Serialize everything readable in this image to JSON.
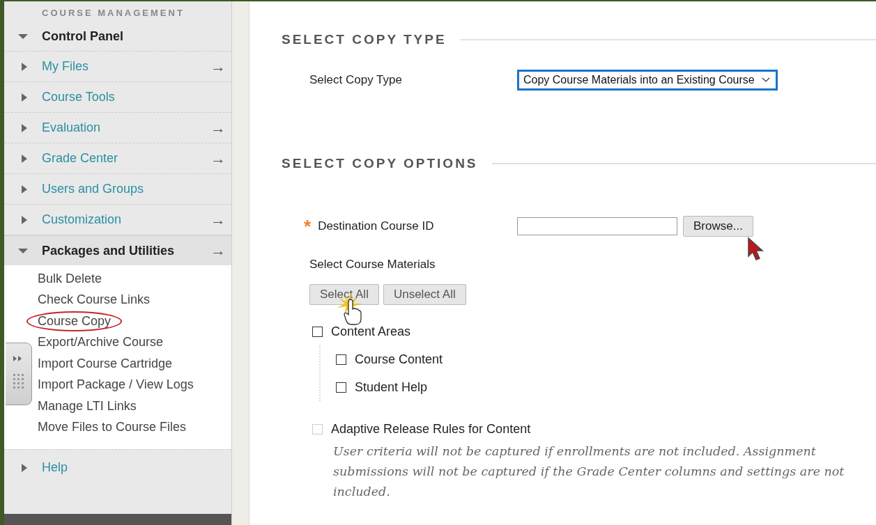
{
  "sidebar": {
    "heading": "COURSE MANAGEMENT",
    "control_panel": {
      "label": "Control Panel",
      "expanded": true
    },
    "items": [
      {
        "label": "My Files",
        "expanded": false,
        "arrow": "→"
      },
      {
        "label": "Course Tools",
        "expanded": false
      },
      {
        "label": "Evaluation",
        "expanded": false,
        "arrow": "→"
      },
      {
        "label": "Grade Center",
        "expanded": false,
        "arrow": "→"
      },
      {
        "label": "Users and Groups",
        "expanded": false
      },
      {
        "label": "Customization",
        "expanded": false,
        "arrow": "→"
      },
      {
        "label": "Packages and Utilities",
        "expanded": true,
        "arrow": "→",
        "children": [
          {
            "label": "Bulk Delete",
            "circled": false
          },
          {
            "label": "Check Course Links",
            "circled": false
          },
          {
            "label": "Course Copy",
            "circled": true
          },
          {
            "label": "Export/Archive Course",
            "circled": false
          },
          {
            "label": "Import Course Cartridge",
            "circled": false
          },
          {
            "label": "Import Package / View Logs",
            "circled": false
          },
          {
            "label": "Manage LTI Links",
            "circled": false
          },
          {
            "label": "Move Files to Course Files",
            "circled": false
          }
        ]
      }
    ],
    "help": {
      "label": "Help",
      "expanded": false
    }
  },
  "copy_type": {
    "title": "SELECT COPY TYPE",
    "label": "Select Copy Type",
    "value": "Copy Course Materials into an Existing Course"
  },
  "copy_options": {
    "title": "SELECT COPY OPTIONS",
    "destination": {
      "label": "Destination Course ID",
      "required_mark": "*",
      "button": "Browse..."
    },
    "materials_label": "Select Course Materials",
    "buttons": [
      "Select All",
      "Unselect All"
    ],
    "materials": [
      {
        "label": "Content Areas",
        "checked": false,
        "children": [
          {
            "label": "Course Content",
            "checked": false
          },
          {
            "label": "Student Help",
            "checked": false
          }
        ]
      }
    ],
    "adaptive": {
      "label": "Adaptive Release Rules for Content",
      "checked": false,
      "disabled": true,
      "note": "User criteria will not be captured if enrollments are not included. Assignment submissions will not be captured if the Grade Center columns and settings are not included."
    }
  }
}
